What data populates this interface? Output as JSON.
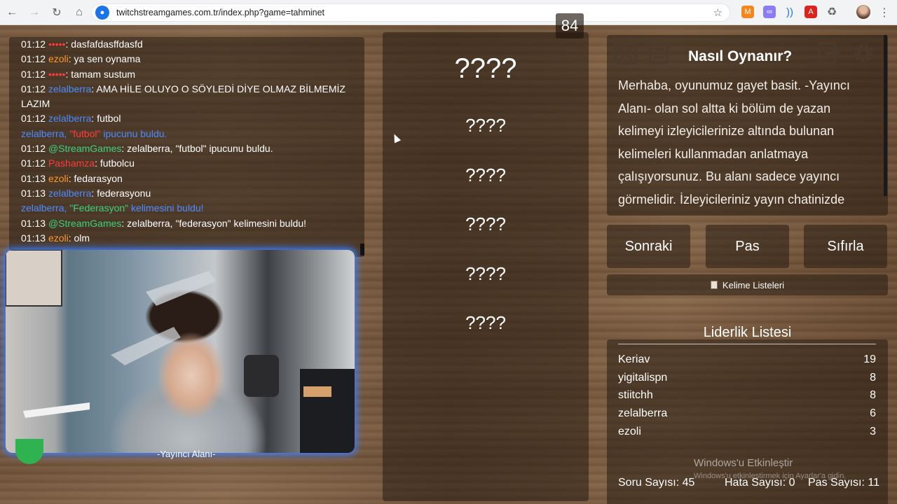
{
  "browser": {
    "url": "twitchstreamgames.com.tr/index.php?game=tahminet"
  },
  "chat": {
    "lines": [
      {
        "time": "01:12 ",
        "user": "•••••",
        "user_color": "#ff3b3b",
        "text": ": dasfafdasffdasfd"
      },
      {
        "time": "01:12 ",
        "user": "ezoli",
        "user_color": "#ff9a2e",
        "text": ": ya sen oynama"
      },
      {
        "time": "01:12 ",
        "user": "•••••",
        "user_color": "#ff3b3b",
        "text": ": tamam sustum"
      },
      {
        "time": "01:12 ",
        "user": "zelalberra",
        "user_color": "#4b8bff",
        "text": ": AMA HİLE OLUYO O SÖYLEDİ DİYE OLMAZ BİLMEMİZ LAZIM"
      },
      {
        "time": "01:12 ",
        "user": "zelalberra",
        "user_color": "#4b8bff",
        "text": ": futbol"
      },
      {
        "time": "",
        "user": "zelalberra, ",
        "user_color": "#4b8bff",
        "highlight": "\"futbol\"",
        "highlight_color": "#ff3b3b",
        "text": " ipucunu buldu.",
        "text_color": "#4b8bff"
      },
      {
        "time": "01:12 ",
        "user": "@StreamGames",
        "user_color": "#3ad07a",
        "text": ": zelalberra, \"futbol\" ipucunu buldu."
      },
      {
        "time": "01:12 ",
        "user": "Pashamza",
        "user_color": "#ff3b3b",
        "text": ": futbolcu"
      },
      {
        "time": "01:13 ",
        "user": "ezoli",
        "user_color": "#ff9a2e",
        "text": ": fedarasyon"
      },
      {
        "time": "01:13 ",
        "user": "zelalberra",
        "user_color": "#4b8bff",
        "text": ": federasyonu"
      },
      {
        "time": "",
        "user": "zelalberra, ",
        "user_color": "#4b8bff",
        "highlight": "\"Federasyon\"",
        "highlight_color": "#3ad07a",
        "text": " kelimesini buldu!",
        "text_color": "#4b8bff"
      },
      {
        "time": "01:13 ",
        "user": "@StreamGames",
        "user_color": "#3ad07a",
        "text": ": zelalberra, \"federasyon\" kelimesini buldu!"
      },
      {
        "time": "01:13 ",
        "user": "ezoli",
        "user_color": "#ff9a2e",
        "text": ": olm"
      }
    ]
  },
  "streamer": {
    "label": "-Yayıncı Alanı-"
  },
  "game": {
    "timer": "84",
    "main_word": "????",
    "clues": [
      "????",
      "????",
      "????",
      "????",
      "????"
    ]
  },
  "howto": {
    "title": "Nasıl Oynanır?",
    "text": "Merhaba, oyunumuz gayet basit. -Yayıncı Alanı- olan sol altta ki bölüm de yazan kelimeyi izleyicilerinize altında bulunan kelimeleri kullanmadan anlatmaya çalışıyorsunuz. Bu alanı sadece yayıncı görmelidir. İzleyicileriniz yayın chatinizde"
  },
  "controls": {
    "next_label": "Sonraki",
    "pass_label": "Pas",
    "reset_label": "Sıfırla",
    "lists_label": "Kelime Listeleri"
  },
  "leaderboard": {
    "title": "Liderlik Listesi",
    "rows": [
      {
        "name": "Keriav",
        "score": "19"
      },
      {
        "name": "yigitalispn",
        "score": "8"
      },
      {
        "name": "stiitchh",
        "score": "8"
      },
      {
        "name": "zelalberra",
        "score": "6"
      },
      {
        "name": "ezoli",
        "score": "3"
      }
    ]
  },
  "stats": {
    "questions": "Soru Sayısı: 45",
    "errors": "Hata Sayısı: 0",
    "passes": "Pas Sayısı: 11"
  },
  "watermark": {
    "line1": "Windows'u Etkinleştir",
    "line2": "Windows'u etkinleştirmek için Ayarlar'a gidin."
  }
}
